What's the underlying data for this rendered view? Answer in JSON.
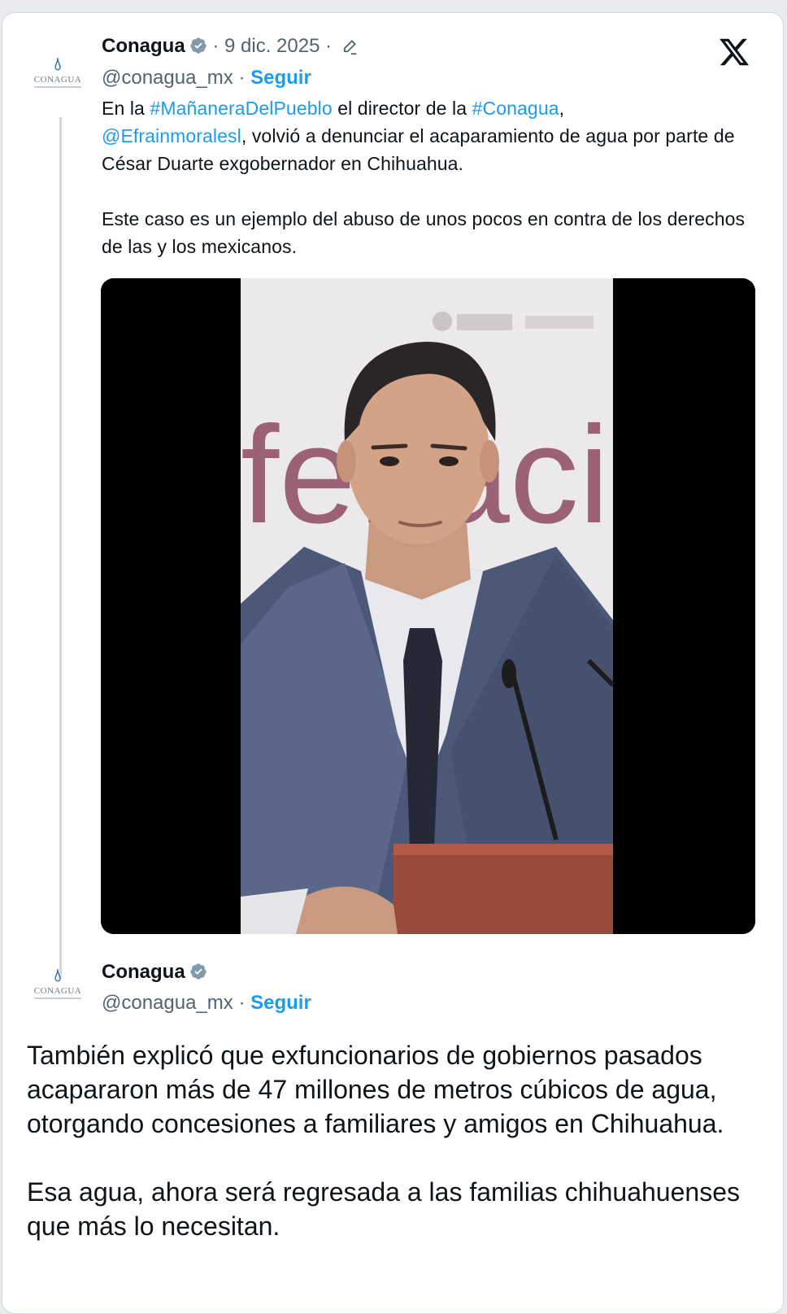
{
  "tweet": {
    "author": "Conagua",
    "avatar_text": "CONAGUA",
    "date": "9 dic. 2025",
    "handle": "@conagua_mx",
    "follow_label": "Seguir",
    "text_prefix": "En la ",
    "hashtag1": "#MañaneraDelPueblo",
    "text_mid": " el director de la ",
    "hashtag2": "#Conagua",
    "text_comma": ",",
    "mention": "@Efrainmoralesl",
    "text_rest": ", volvió a denunciar el acaparamiento de agua por parte de César Duarte exgobernador en Chihuahua.",
    "paragraph2": "Este caso es un ejemplo del abuso de unos pocos en contra de los derechos de las y los mexicanos.",
    "video_background_text": "fe..aci"
  },
  "reply": {
    "author": "Conagua",
    "avatar_text": "CONAGUA",
    "handle": "@conagua_mx",
    "follow_label": "Seguir",
    "paragraph1": "También explicó que exfuncionarios de gobiernos pasados acapararon más de 47 millones de metros cúbicos de agua, otorgando concesiones a familiares y amigos en Chihuahua.",
    "paragraph2": "Esa agua, ahora será regresada a las familias chihuahuenses que más lo necesitan."
  },
  "colors": {
    "link": "#1d9bf0",
    "verified": "#829aab",
    "muted": "#536471",
    "text": "#0f1419"
  },
  "icons": [
    "verified-badge-icon",
    "pencil-icon",
    "x-logo-icon",
    "water-drop-icon"
  ]
}
